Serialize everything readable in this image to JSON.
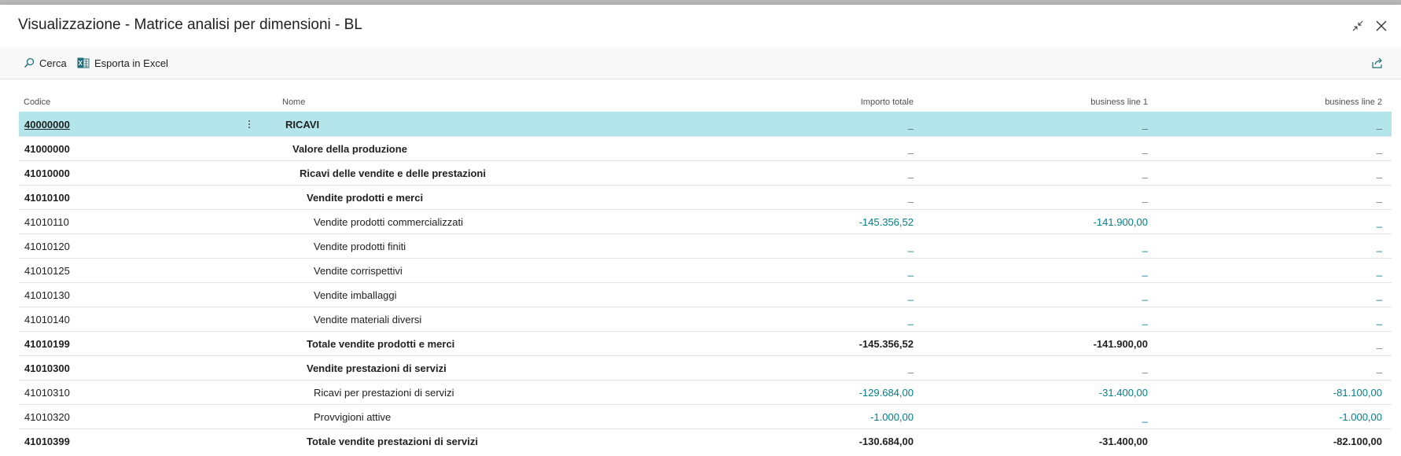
{
  "dialog": {
    "title": "Visualizzazione - Matrice analisi per dimensioni - BL",
    "collapse_icon": "collapse-icon",
    "close_icon": "close-icon"
  },
  "actions": {
    "search_label": "Cerca",
    "excel_label": "Esporta in Excel",
    "share_icon": "share-icon"
  },
  "columns": {
    "code": "Codice",
    "name": "Nome",
    "total": "Importo totale",
    "bl1": "business line 1",
    "bl2": "business line 2"
  },
  "colors": {
    "selected_row": "#b3e5ea",
    "amount_link": "#00808a"
  },
  "rows": [
    {
      "code": "40000000",
      "name": "RICAVI",
      "total": "_",
      "bl1": "_",
      "bl2": "_"
    },
    {
      "code": "41000000",
      "name": "Valore della produzione",
      "total": "_",
      "bl1": "_",
      "bl2": "_"
    },
    {
      "code": "41010000",
      "name": "Ricavi delle vendite e delle prestazioni",
      "total": "_",
      "bl1": "_",
      "bl2": "_"
    },
    {
      "code": "41010100",
      "name": "Vendite prodotti e merci",
      "total": "_",
      "bl1": "_",
      "bl2": "_"
    },
    {
      "code": "41010110",
      "name": "Vendite prodotti commercializzati",
      "total": "-145.356,52",
      "bl1": "-141.900,00",
      "bl2": "_"
    },
    {
      "code": "41010120",
      "name": "Vendite prodotti finiti",
      "total": "_",
      "bl1": "_",
      "bl2": "_"
    },
    {
      "code": "41010125",
      "name": "Vendite corrispettivi",
      "total": "_",
      "bl1": "_",
      "bl2": "_"
    },
    {
      "code": "41010130",
      "name": "Vendite imballaggi",
      "total": "_",
      "bl1": "_",
      "bl2": "_"
    },
    {
      "code": "41010140",
      "name": "Vendite materiali diversi",
      "total": "_",
      "bl1": "_",
      "bl2": "_"
    },
    {
      "code": "41010199",
      "name": "Totale vendite prodotti e merci",
      "total": "-145.356,52",
      "bl1": "-141.900,00",
      "bl2": "_"
    },
    {
      "code": "41010300",
      "name": "Vendite prestazioni di servizi",
      "total": "_",
      "bl1": "_",
      "bl2": "_"
    },
    {
      "code": "41010310",
      "name": "Ricavi per prestazioni di servizi",
      "total": "-129.684,00",
      "bl1": "-31.400,00",
      "bl2": "-81.100,00"
    },
    {
      "code": "41010320",
      "name": "Provvigioni attive",
      "total": "-1.000,00",
      "bl1": "_",
      "bl2": "-1.000,00"
    },
    {
      "code": "41010399",
      "name": "Totale vendite prestazioni di servizi",
      "total": "-130.684,00",
      "bl1": "-31.400,00",
      "bl2": "-82.100,00"
    }
  ]
}
